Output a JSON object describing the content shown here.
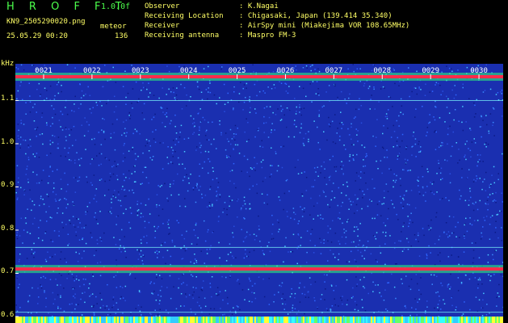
{
  "header": {
    "app_title": "H R O F F T",
    "version": "1.0.0f",
    "file_name": "KN9_2505290020.png",
    "mode": "meteor",
    "datetime": "25.05.29 00:20",
    "count": "136"
  },
  "info": [
    {
      "label": "Observer",
      "value": ": K.Nagai"
    },
    {
      "label": "Receiving Location",
      "value": ": Chigasaki, Japan (139.414 35.340)"
    },
    {
      "label": "Receiver",
      "value": ": AirSpy mini (Miakejima VOR 108.65MHz)"
    },
    {
      "label": "Receiving antenna",
      "value": ": Maspro FM-3"
    }
  ],
  "colors": {
    "title_green": "#4cff4c",
    "info_yellow": "#ffff66",
    "background_blue": "#1a2fb0",
    "band_red": "#ff2a4a",
    "band_green": "#33ff77",
    "line_cyan": "#7fffff"
  },
  "chart_data": {
    "type": "heatmap",
    "ylabel": "kHz",
    "y_ticks": [
      "1.1",
      "1.0",
      "0.9",
      "0.8",
      "0.7",
      "0.6"
    ],
    "y_tick_values": [
      1.1,
      1.0,
      0.9,
      0.8,
      0.7,
      0.6
    ],
    "ylim": [
      0.585,
      1.185
    ],
    "x_ticks": [
      "0021",
      "0022",
      "0023",
      "0024",
      "0025",
      "0026",
      "0027",
      "0028",
      "0029",
      "0030"
    ],
    "bands": [
      {
        "freq": 1.155,
        "intensity": "strong"
      },
      {
        "freq": 0.71,
        "intensity": "strong"
      },
      {
        "freq": 1.1,
        "intensity": "weak"
      },
      {
        "freq": 0.76,
        "intensity": "weak"
      },
      {
        "freq": 0.61,
        "intensity": "weak"
      }
    ]
  }
}
